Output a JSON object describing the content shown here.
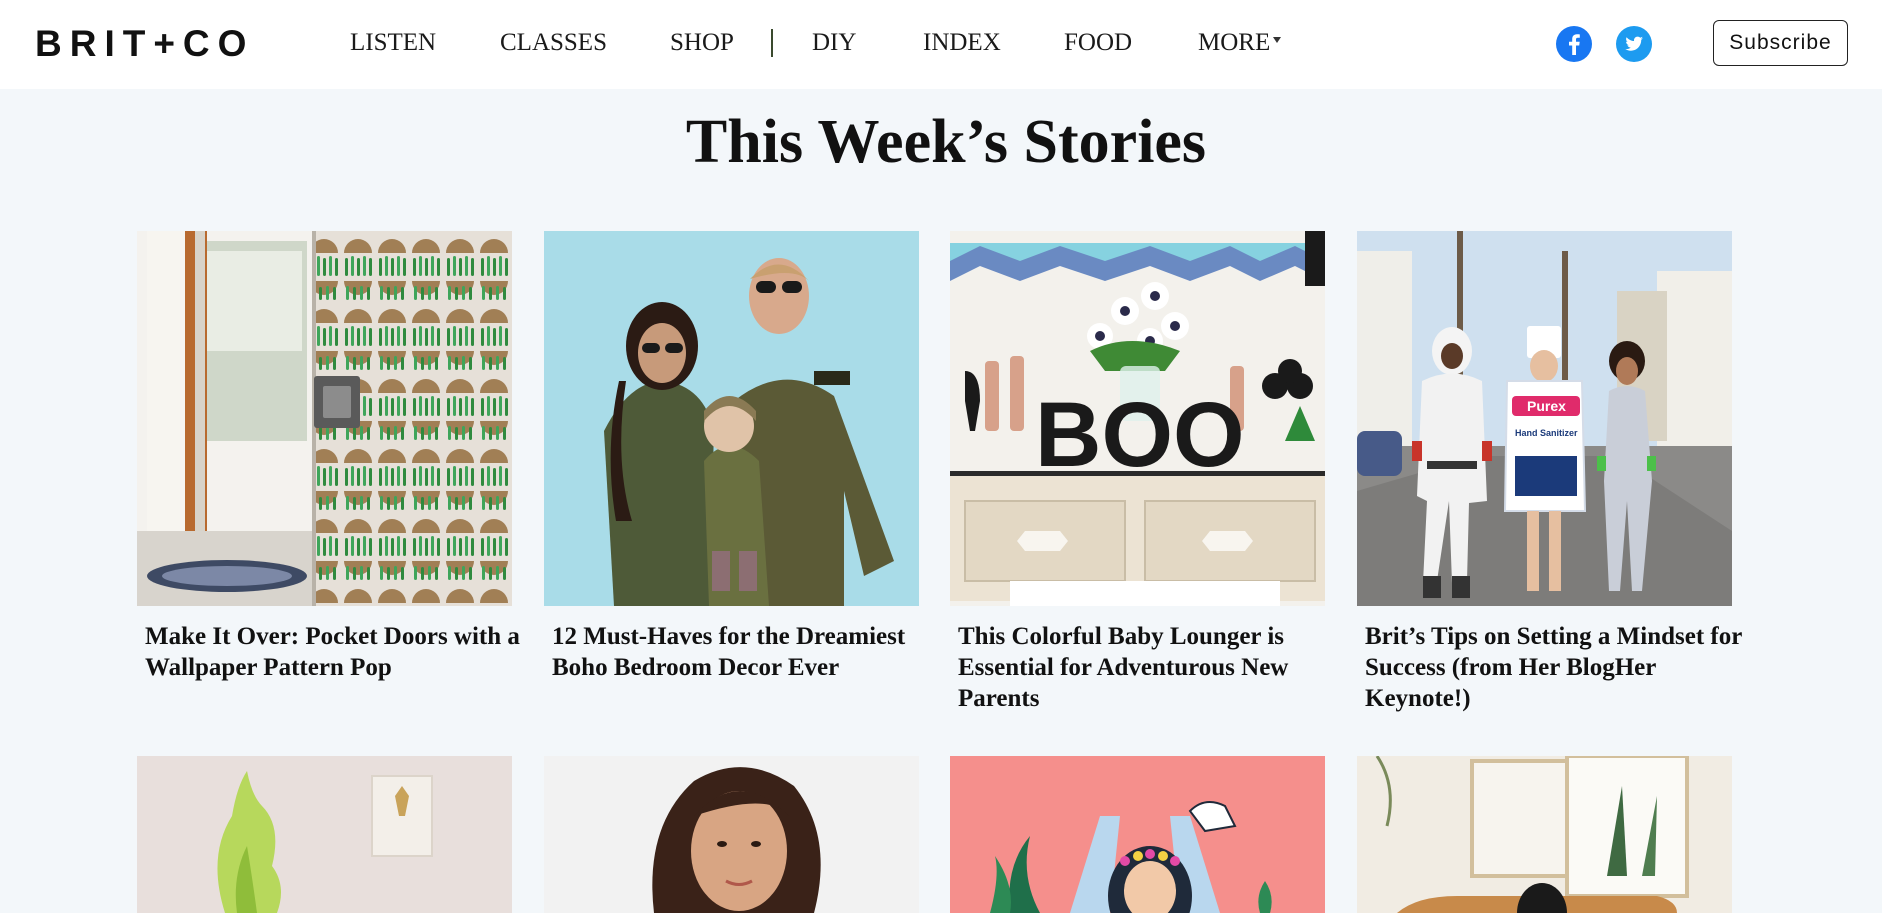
{
  "header": {
    "logo": "BRIT+CO",
    "nav": [
      "LISTEN",
      "CLASSES",
      "SHOP",
      "DIY",
      "INDEX",
      "FOOD",
      "MORE"
    ],
    "subscribe_label": "Subscribe",
    "icons": {
      "facebook": "facebook-icon",
      "twitter": "twitter-icon",
      "more": "caret-down-icon"
    },
    "colors": {
      "facebook": "#1877f2",
      "twitter": "#1d9bf0"
    }
  },
  "main": {
    "section_title": "This Week’s Stories",
    "stories": [
      {
        "title": "Make It Over: Pocket Doors with a Wallpaper Pattern Pop"
      },
      {
        "title": "12 Must-Haves for the Dreamiest Boho Bedroom Decor Ever"
      },
      {
        "title": "This Colorful Baby Lounger is Essential for Adventurous New Parents"
      },
      {
        "title": "Brit’s Tips on Setting a Mindset for Success (from Her BlogHer Keynote!)"
      }
    ],
    "image_text": {
      "boo_sign": "BOO",
      "sanitizer_brand": "Purex",
      "sanitizer_label": "Hand Sanitizer"
    }
  }
}
